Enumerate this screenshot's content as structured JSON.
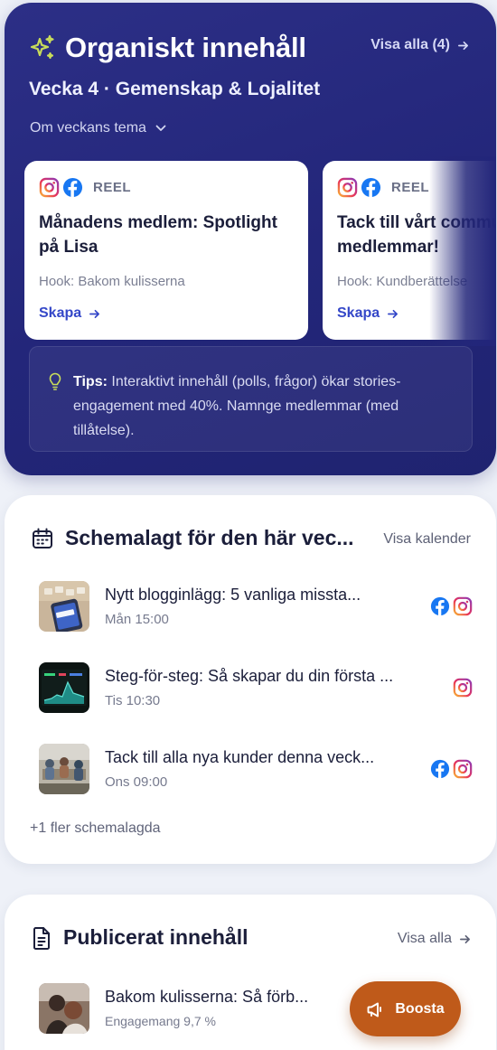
{
  "organic": {
    "title": "Organiskt innehåll",
    "view_all": "Visa alla (4)",
    "week": "Vecka 4 · Gemenskap & Lojalitet",
    "theme_toggle": "Om veckans tema",
    "cards": [
      {
        "type": "REEL",
        "title_line1": "Månadens medlem: Spotlight",
        "title_line2": "på Lisa",
        "hook": "Hook: Bakom kulisserna",
        "action": "Skapa"
      },
      {
        "type": "REEL",
        "title_line1": "Tack till vårt community av",
        "title_line2": "medlemmar!",
        "hook": "Hook: Kundberättelse",
        "action": "Skapa"
      }
    ],
    "tip_label": "Tips:",
    "tip_text": " Interaktivt innehåll (polls, frågor) ökar stories-engagement med 40%. Namnge medlemmar (med tillåtelse)."
  },
  "scheduled": {
    "title": "Schemalagt för den här vec...",
    "link": "Visa kalender",
    "items": [
      {
        "title": "Nytt blogginlägg: 5 vanliga missta...",
        "time": "Mån 15:00",
        "platforms": [
          "facebook-icon",
          "instagram-icon"
        ]
      },
      {
        "title": "Steg-för-steg: Så skapar du din första ...",
        "time": "Tis 10:30",
        "platforms": [
          "instagram-icon"
        ]
      },
      {
        "title": "Tack till alla nya kunder denna veck...",
        "time": "Ons 09:00",
        "platforms": [
          "facebook-icon",
          "instagram-icon"
        ]
      }
    ],
    "more": "+1 fler schemalagda"
  },
  "published": {
    "title": "Publicerat innehåll",
    "link": "Visa alla",
    "items": [
      {
        "title": "Bakom kulisserna: Så förb...",
        "meta": "Engagemang 9,7 %"
      }
    ]
  },
  "boost": {
    "label": "Boosta"
  },
  "colors": {
    "navy": "#23267a",
    "accent_blue": "#3447c8",
    "boost_orange": "#bf5a1a",
    "sparkle": "#c8dc5a"
  }
}
